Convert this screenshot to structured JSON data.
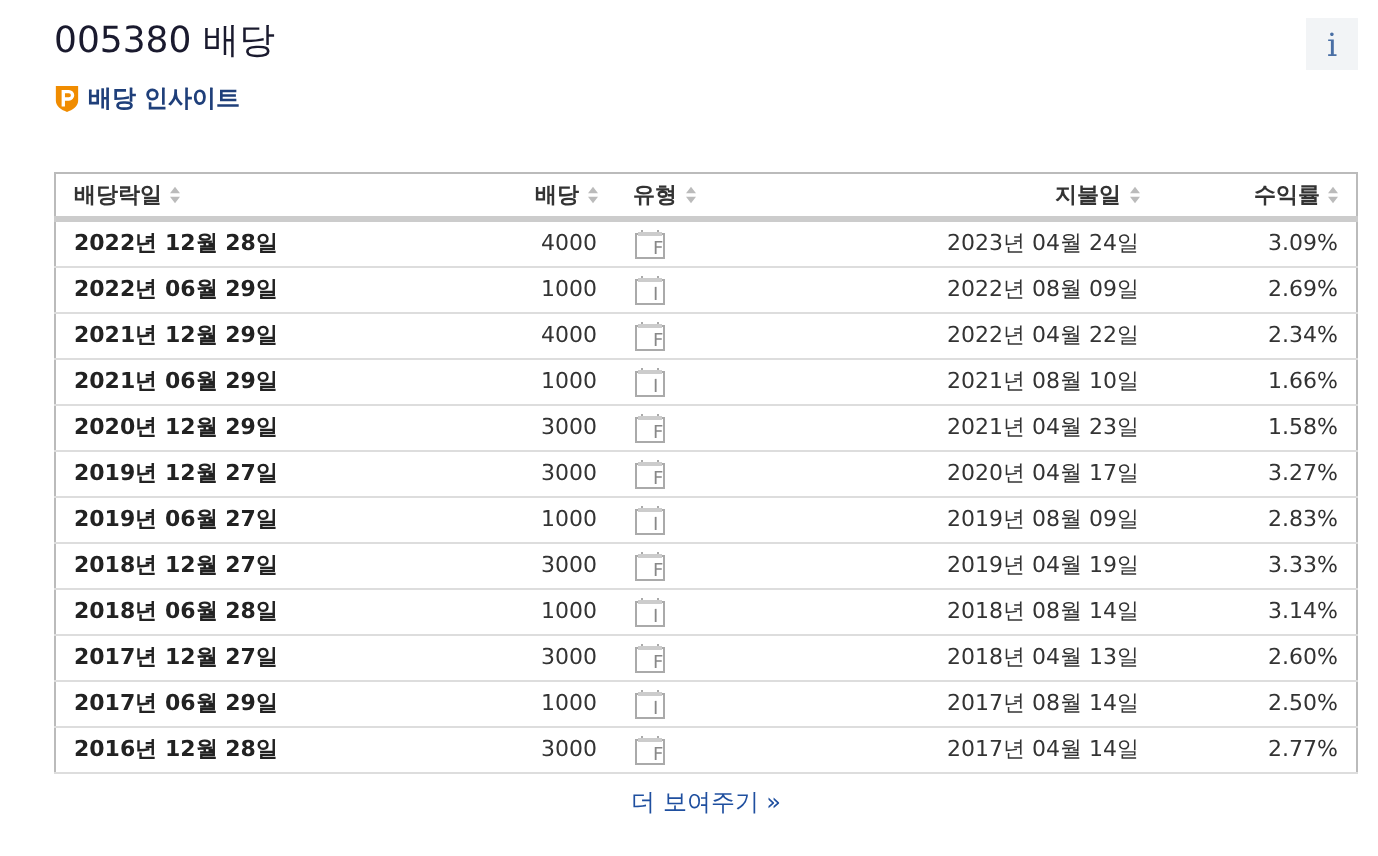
{
  "title": "005380 배당",
  "info_button": "i",
  "insight_link": "배당 인사이트",
  "table": {
    "columns": [
      {
        "label": "배당락일"
      },
      {
        "label": "배당"
      },
      {
        "label": "유형"
      },
      {
        "label": "지불일"
      },
      {
        "label": "수익률"
      }
    ],
    "rows": [
      {
        "ex_date": "2022년 12월 28일",
        "dividend": "4000",
        "type": "F",
        "pay_date": "2023년 04월 24일",
        "yield": "3.09%"
      },
      {
        "ex_date": "2022년 06월 29일",
        "dividend": "1000",
        "type": "I",
        "pay_date": "2022년 08월 09일",
        "yield": "2.69%"
      },
      {
        "ex_date": "2021년 12월 29일",
        "dividend": "4000",
        "type": "F",
        "pay_date": "2022년 04월 22일",
        "yield": "2.34%"
      },
      {
        "ex_date": "2021년 06월 29일",
        "dividend": "1000",
        "type": "I",
        "pay_date": "2021년 08월 10일",
        "yield": "1.66%"
      },
      {
        "ex_date": "2020년 12월 29일",
        "dividend": "3000",
        "type": "F",
        "pay_date": "2021년 04월 23일",
        "yield": "1.58%"
      },
      {
        "ex_date": "2019년 12월 27일",
        "dividend": "3000",
        "type": "F",
        "pay_date": "2020년 04월 17일",
        "yield": "3.27%"
      },
      {
        "ex_date": "2019년 06월 27일",
        "dividend": "1000",
        "type": "I",
        "pay_date": "2019년 08월 09일",
        "yield": "2.83%"
      },
      {
        "ex_date": "2018년 12월 27일",
        "dividend": "3000",
        "type": "F",
        "pay_date": "2019년 04월 19일",
        "yield": "3.33%"
      },
      {
        "ex_date": "2018년 06월 28일",
        "dividend": "1000",
        "type": "I",
        "pay_date": "2018년 08월 14일",
        "yield": "3.14%"
      },
      {
        "ex_date": "2017년 12월 27일",
        "dividend": "3000",
        "type": "F",
        "pay_date": "2018년 04월 13일",
        "yield": "2.60%"
      },
      {
        "ex_date": "2017년 06월 29일",
        "dividend": "1000",
        "type": "I",
        "pay_date": "2017년 08월 14일",
        "yield": "2.50%"
      },
      {
        "ex_date": "2016년 12월 28일",
        "dividend": "3000",
        "type": "F",
        "pay_date": "2017년 04월 14일",
        "yield": "2.77%"
      }
    ]
  },
  "more_link": "더 보여주기 »"
}
